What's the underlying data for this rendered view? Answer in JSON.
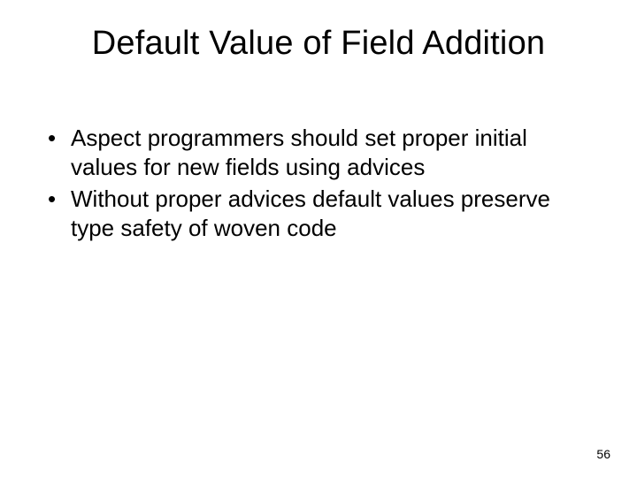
{
  "slide": {
    "title": "Default Value of Field Addition",
    "bullets": [
      "Aspect programmers should set proper initial values for new fields using advices",
      "Without proper advices default values preserve type safety of woven code"
    ],
    "page_number": "56"
  }
}
